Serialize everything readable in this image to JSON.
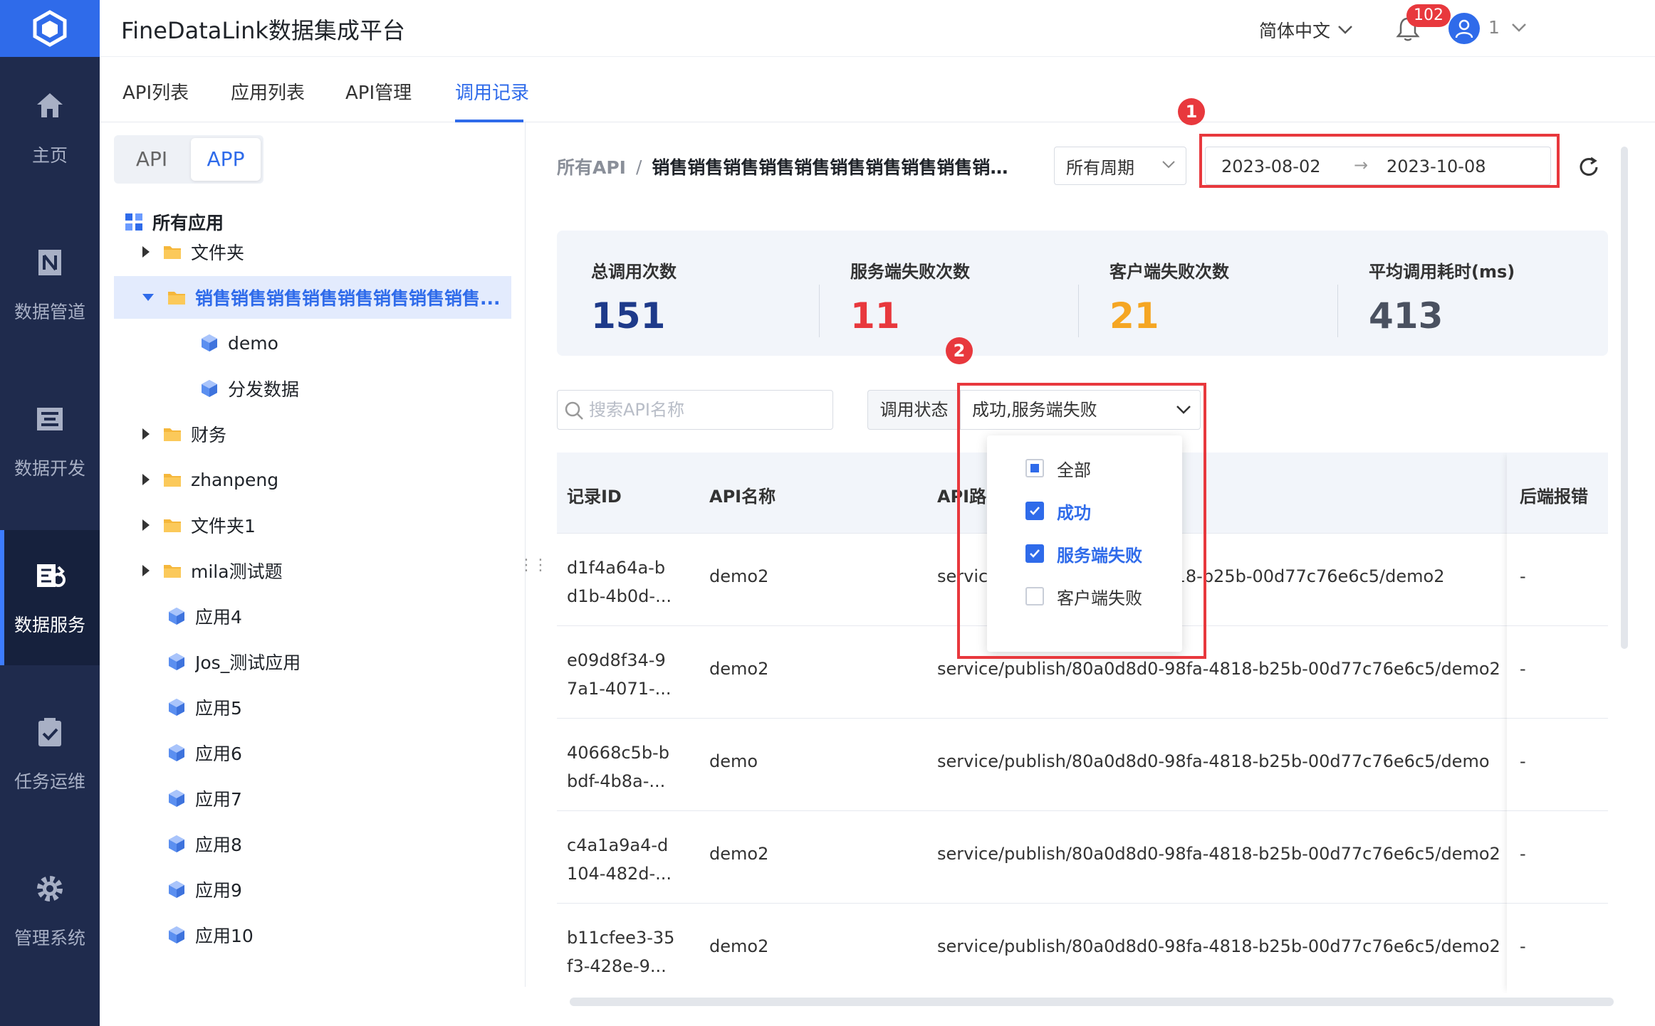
{
  "app": {
    "title": "FineDataLink数据集成平台"
  },
  "nav": {
    "items": [
      {
        "label": "主页",
        "icon": "home-icon"
      },
      {
        "label": "数据管道",
        "icon": "pipeline-icon"
      },
      {
        "label": "数据开发",
        "icon": "dev-icon"
      },
      {
        "label": "数据服务",
        "icon": "data-service-icon",
        "active": true
      },
      {
        "label": "任务运维",
        "icon": "clipboard-check-icon"
      },
      {
        "label": "管理系统",
        "icon": "gear-icon"
      }
    ]
  },
  "header": {
    "language": "简体中文",
    "notifications": "102",
    "user": "1"
  },
  "tabs": [
    {
      "label": "API列表"
    },
    {
      "label": "应用列表"
    },
    {
      "label": "API管理"
    },
    {
      "label": "调用记录",
      "active": true
    }
  ],
  "tree": {
    "segment": {
      "api": "API",
      "app": "APP",
      "active": "APP"
    },
    "root": "所有应用",
    "items": [
      {
        "label": "文件夹",
        "type": "folder"
      },
      {
        "label": "销售销售销售销售销售销售销售销售...",
        "type": "folder",
        "open": true,
        "selected": true
      },
      {
        "label": "demo",
        "type": "app"
      },
      {
        "label": "分发数据",
        "type": "app"
      },
      {
        "label": "财务",
        "type": "folder"
      },
      {
        "label": "zhanpeng",
        "type": "folder"
      },
      {
        "label": "文件夹1",
        "type": "folder"
      },
      {
        "label": "mila测试题",
        "type": "folder"
      },
      {
        "label": "应用4",
        "type": "app"
      },
      {
        "label": "Jos_测试应用",
        "type": "app"
      },
      {
        "label": "应用5",
        "type": "app"
      },
      {
        "label": "应用6",
        "type": "app"
      },
      {
        "label": "应用7",
        "type": "app"
      },
      {
        "label": "应用8",
        "type": "app"
      },
      {
        "label": "应用9",
        "type": "app"
      },
      {
        "label": "应用10",
        "type": "app"
      }
    ]
  },
  "breadcrumb": {
    "root": "所有API",
    "sep": "/",
    "current": "销售销售销售销售销售销售销售销售销售销售销售..."
  },
  "filters": {
    "period": "所有周期",
    "date_start": "2023-08-02",
    "date_arrow": "→",
    "date_end": "2023-10-08",
    "search_placeholder": "搜索API名称",
    "status_label": "调用状态",
    "status_value": "成功,服务端失败"
  },
  "markers": {
    "one": "1",
    "two": "2"
  },
  "stats": [
    {
      "label": "总调用次数",
      "value": "151",
      "color": "#1e3a8a"
    },
    {
      "label": "服务端失败次数",
      "value": "11",
      "color": "#e8383d"
    },
    {
      "label": "客户端失败次数",
      "value": "21",
      "color": "#f5a623"
    },
    {
      "label": "平均调用耗时(ms)",
      "value": "413",
      "color": "#4a5160"
    }
  ],
  "table": {
    "columns": [
      "记录ID",
      "API名称",
      "API路",
      "后端报错"
    ],
    "rows": [
      {
        "id1": "d1f4a64a-b",
        "id2": "d1b-4b0d-...",
        "name": "demo2",
        "path": "servic",
        "path_tail": "8fa-4818-b25b-00d77c76e6c5/demo2",
        "err": "-"
      },
      {
        "id1": "e09d8f34-9",
        "id2": "7a1-4071-...",
        "name": "demo2",
        "path": "service/publish/80a0d8d0-98fa-4818-b25b-00d77c76e6c5/demo2",
        "err": "-"
      },
      {
        "id1": "40668c5b-b",
        "id2": "bdf-4b8a-...",
        "name": "demo",
        "path": "service/publish/80a0d8d0-98fa-4818-b25b-00d77c76e6c5/demo",
        "err": "-"
      },
      {
        "id1": "c4a1a9a4-d",
        "id2": "104-482d-...",
        "name": "demo2",
        "path": "service/publish/80a0d8d0-98fa-4818-b25b-00d77c76e6c5/demo2",
        "err": "-"
      },
      {
        "id1": "b11cfee3-35",
        "id2": "f3-428e-9...",
        "name": "demo2",
        "path": "service/publish/80a0d8d0-98fa-4818-b25b-00d77c76e6c5/demo2",
        "err": "-"
      }
    ]
  },
  "dropdown": {
    "options": [
      {
        "label": "全部",
        "state": "partial"
      },
      {
        "label": "成功",
        "state": "checked"
      },
      {
        "label": "服务端失败",
        "state": "checked"
      },
      {
        "label": "客户端失败",
        "state": "unchecked"
      }
    ]
  },
  "colors": {
    "accent": "#2f6bea",
    "nav_bg": "#1f2b4d",
    "highlight": "#e8383d"
  }
}
